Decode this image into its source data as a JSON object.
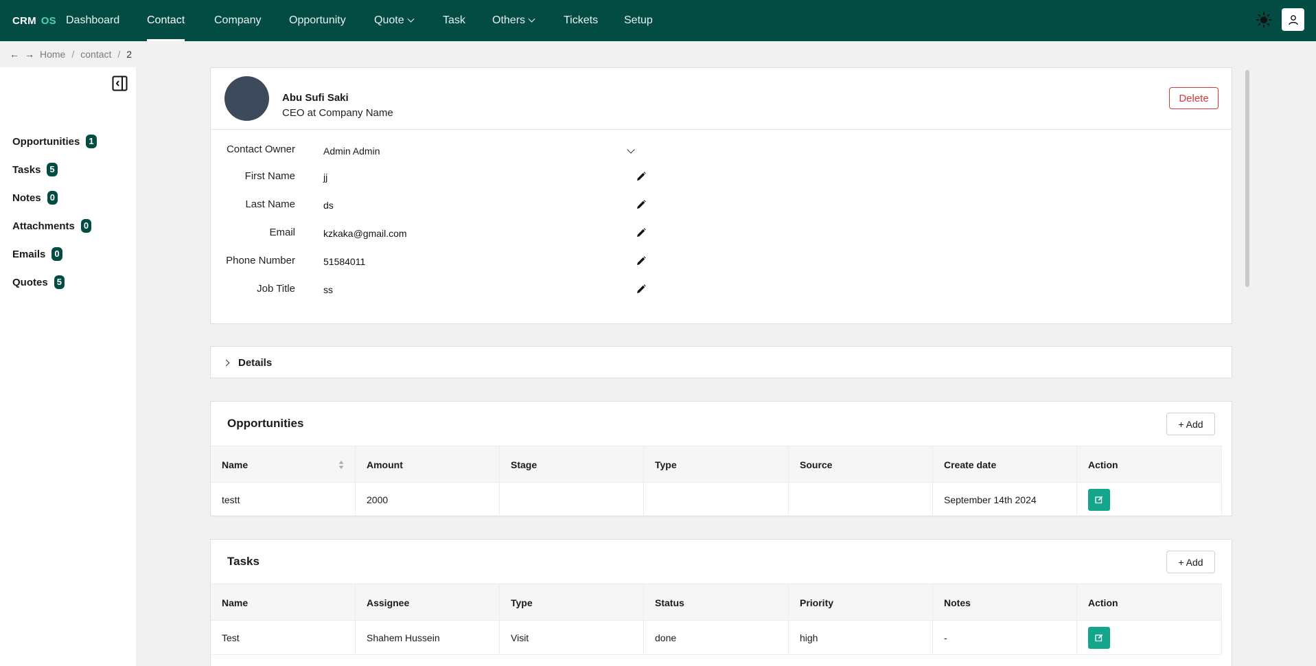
{
  "brand": {
    "crm": "CRM",
    "os": "OS"
  },
  "nav": [
    {
      "label": "Dashboard",
      "active": false,
      "dropdown": false
    },
    {
      "label": "Contact",
      "active": true,
      "dropdown": false
    },
    {
      "label": "Company",
      "active": false,
      "dropdown": false
    },
    {
      "label": "Opportunity",
      "active": false,
      "dropdown": false
    },
    {
      "label": "Quote",
      "active": false,
      "dropdown": true
    },
    {
      "label": "Task",
      "active": false,
      "dropdown": false
    },
    {
      "label": "Others",
      "active": false,
      "dropdown": true
    },
    {
      "label": "Tickets",
      "active": false,
      "dropdown": false
    },
    {
      "label": "Setup",
      "active": false,
      "dropdown": false
    }
  ],
  "breadcrumb": {
    "home": "Home",
    "section": "contact",
    "current": "2"
  },
  "sidebar": {
    "items": [
      {
        "label": "Opportunities",
        "count": "1"
      },
      {
        "label": "Tasks",
        "count": "5"
      },
      {
        "label": "Notes",
        "count": "0"
      },
      {
        "label": "Attachments",
        "count": "0"
      },
      {
        "label": "Emails",
        "count": "0"
      },
      {
        "label": "Quotes",
        "count": "5"
      }
    ]
  },
  "profile": {
    "name": "Abu Sufi Saki",
    "role": "CEO at Company Name",
    "delete_label": "Delete",
    "owner_label": "Contact Owner",
    "owner_value": "Admin Admin",
    "fields": [
      {
        "label": "First Name",
        "value": "jj"
      },
      {
        "label": "Last Name",
        "value": "ds"
      },
      {
        "label": "Email",
        "value": "kzkaka@gmail.com"
      },
      {
        "label": "Phone Number",
        "value": "51584011"
      },
      {
        "label": "Job Title",
        "value": "ss"
      }
    ]
  },
  "details": {
    "label": "Details"
  },
  "opportunities": {
    "title": "Opportunities",
    "add_label": "+ Add",
    "columns": [
      "Name",
      "Amount",
      "Stage",
      "Type",
      "Source",
      "Create date",
      "Action"
    ],
    "rows": [
      {
        "name": "testt",
        "amount": "2000",
        "stage": "",
        "type": "",
        "source": "",
        "create_date": "September 14th 2024"
      }
    ]
  },
  "tasks": {
    "title": "Tasks",
    "add_label": "+ Add",
    "columns": [
      "Name",
      "Assignee",
      "Type",
      "Status",
      "Priority",
      "Notes",
      "Action"
    ],
    "rows": [
      {
        "name": "Test",
        "assignee": "Shahem Hussein",
        "type": "Visit",
        "status": "done",
        "priority": "high",
        "notes": "-"
      }
    ]
  },
  "colors": {
    "nav_bg": "#034c44",
    "accent": "#14a58d",
    "danger": "#d9363e",
    "badge_bg": "#034c44"
  }
}
